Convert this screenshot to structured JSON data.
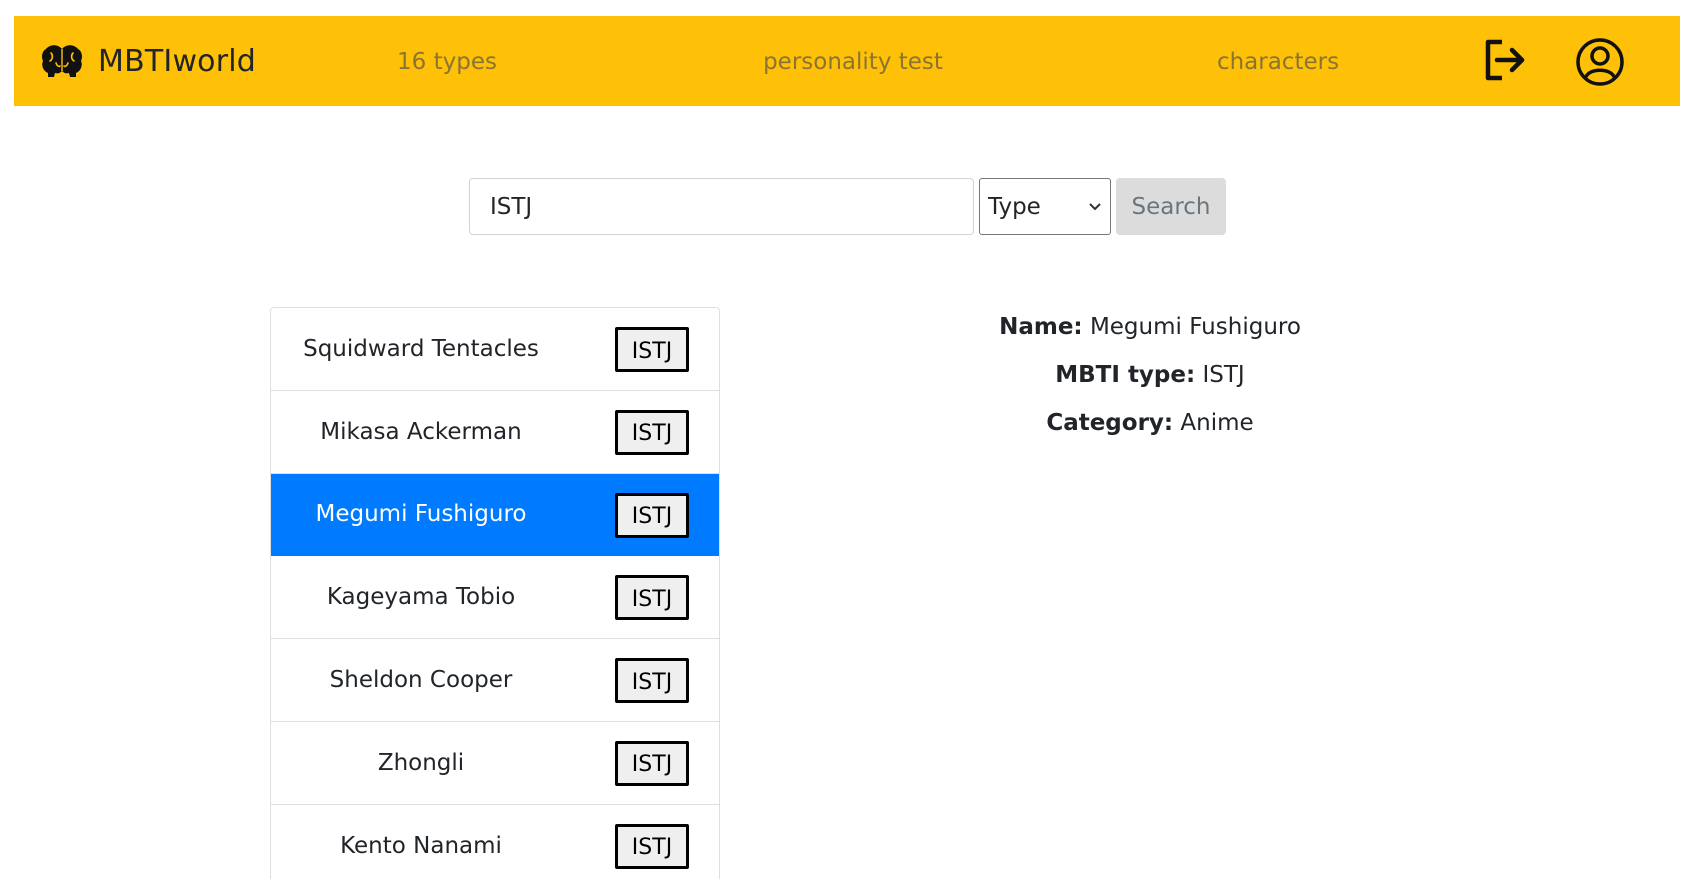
{
  "navbar": {
    "brand": "MBTIworld",
    "links": [
      "16 types",
      "personality test",
      "characters"
    ],
    "icons": {
      "logout": "logout-icon",
      "profile": "user-circle-icon",
      "brand": "brain-heads-logo-icon"
    },
    "color": "#ffc107"
  },
  "search": {
    "value": "ISTJ",
    "select_value": "Type",
    "button_label": "Search"
  },
  "characters": [
    {
      "name": "Squidward Tentacles",
      "type": "ISTJ"
    },
    {
      "name": "Mikasa Ackerman",
      "type": "ISTJ"
    },
    {
      "name": "Megumi Fushiguro",
      "type": "ISTJ",
      "selected": true
    },
    {
      "name": "Kageyama Tobio",
      "type": "ISTJ"
    },
    {
      "name": "Sheldon Cooper",
      "type": "ISTJ"
    },
    {
      "name": "Zhongli",
      "type": "ISTJ"
    },
    {
      "name": "Kento Nanami",
      "type": "ISTJ"
    }
  ],
  "details": {
    "name_label": "Name:",
    "name_value": "Megumi Fushiguro",
    "type_label": "MBTI type:",
    "type_value": "ISTJ",
    "category_label": "Category:",
    "category_value": "Anime"
  },
  "colors": {
    "active": "#007bff"
  }
}
